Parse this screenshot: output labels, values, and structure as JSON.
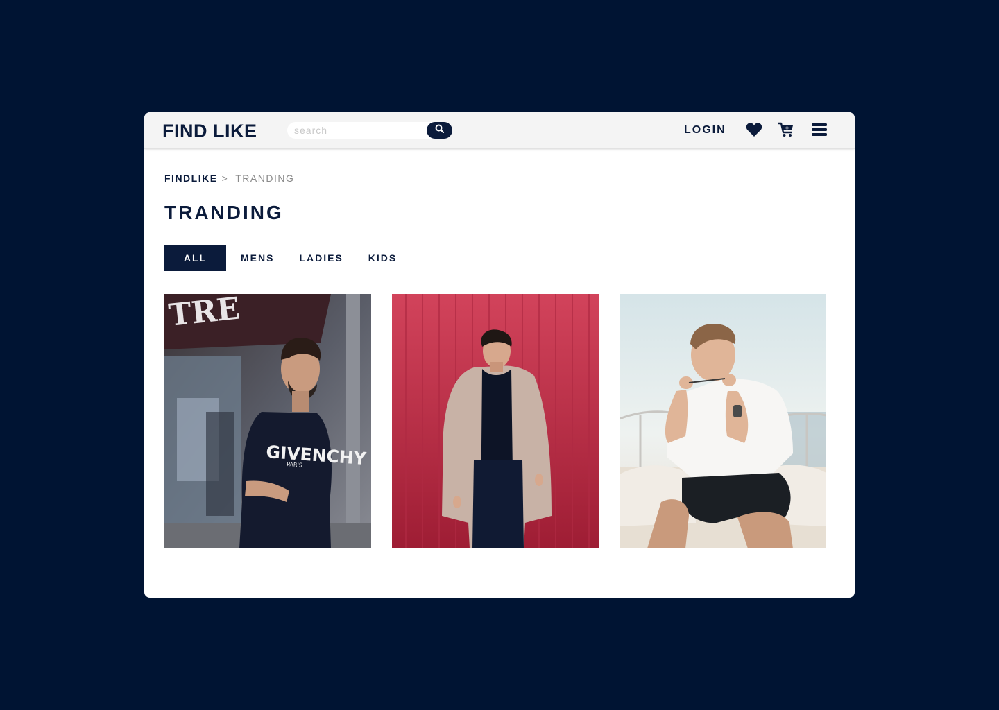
{
  "header": {
    "logo": "FIND LIKE",
    "search_placeholder": "search",
    "search_value": "",
    "login_label": "LOGIN",
    "icons": [
      "search-icon",
      "heart-icon",
      "cart-icon",
      "menu-icon"
    ]
  },
  "breadcrumb": {
    "root": "FINDLIKE",
    "separator": ">",
    "current": "TRANDING"
  },
  "page": {
    "title": "TRANDING"
  },
  "tabs": [
    {
      "label": "ALL",
      "active": true
    },
    {
      "label": "MENS",
      "active": false
    },
    {
      "label": "LADIES",
      "active": false
    },
    {
      "label": "KIDS",
      "active": false
    }
  ],
  "products": [
    {
      "image": "man in black GIVENCHY sweatshirt on street",
      "print_text": "GIVENCHY",
      "print_sub": "PARIS"
    },
    {
      "image": "man in beige coat against red wall"
    },
    {
      "image": "man in white t-shirt on boat"
    }
  ],
  "colors": {
    "background": "#001433",
    "brand": "#0b1b3b",
    "card": "#ffffff",
    "topbar": "#f4f4f4",
    "muted": "#8a8a8a"
  }
}
